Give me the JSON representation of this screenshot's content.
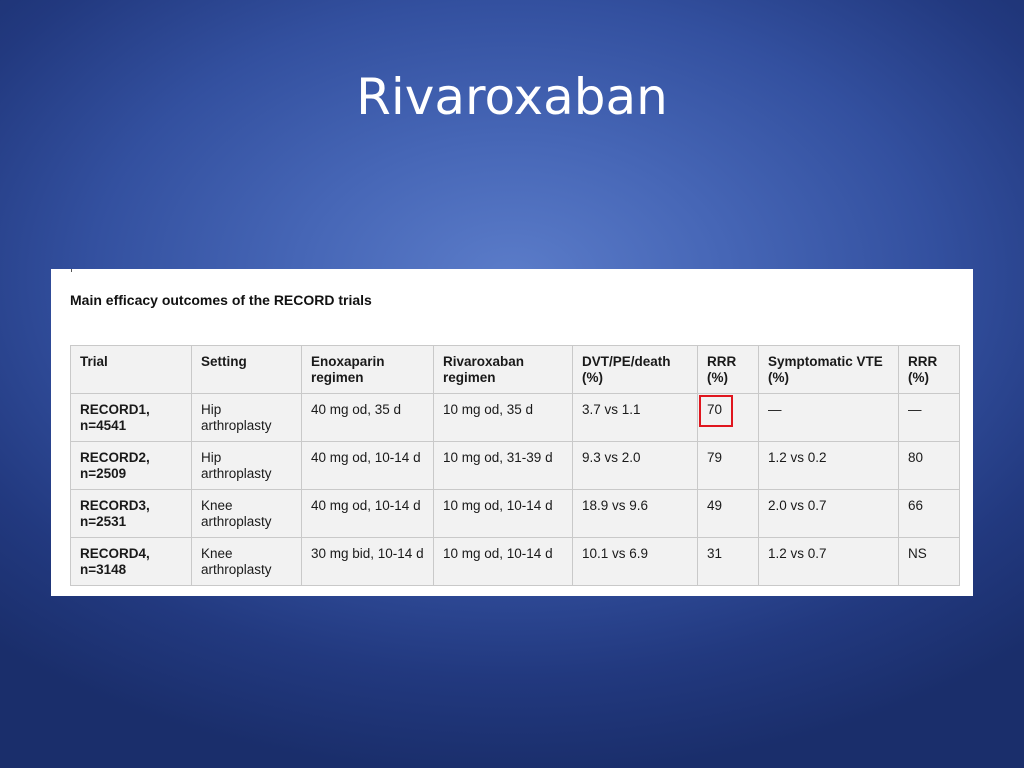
{
  "slide": {
    "title": "Rivaroxaban"
  },
  "table": {
    "caption": "Main efficacy outcomes of the RECORD trials",
    "headers": [
      "Trial",
      "Setting",
      "Enoxaparin regimen",
      "Rivaroxaban regimen",
      "DVT/PE/death (%)",
      "RRR (%)",
      "Symptomatic VTE (%)",
      "RRR (%)"
    ],
    "rows": [
      {
        "trial": "RECORD1, n=4541",
        "setting": "Hip arthroplasty",
        "enoxaparin": "40 mg od, 35 d",
        "rivaroxaban": "10 mg od, 35 d",
        "dvt_pe_death": "3.7 vs 1.1",
        "rrr": "70",
        "symptomatic_vte": "—",
        "rrr_vte": "—"
      },
      {
        "trial": "RECORD2, n=2509",
        "setting": "Hip arthroplasty",
        "enoxaparin": "40 mg od, 10-14 d",
        "rivaroxaban": "10 mg od, 31-39 d",
        "dvt_pe_death": "9.3 vs 2.0",
        "rrr": "79",
        "symptomatic_vte": "1.2 vs 0.2",
        "rrr_vte": "80"
      },
      {
        "trial": "RECORD3, n=2531",
        "setting": "Knee arthroplasty",
        "enoxaparin": "40 mg od, 10-14 d",
        "rivaroxaban": "10 mg od, 10-14 d",
        "dvt_pe_death": "18.9 vs 9.6",
        "rrr": "49",
        "symptomatic_vte": "2.0 vs 0.7",
        "rrr_vte": "66"
      },
      {
        "trial": "RECORD4, n=3148",
        "setting": "Knee arthroplasty",
        "enoxaparin": "30 mg bid, 10-14 d",
        "rivaroxaban": "10 mg od, 10-14 d",
        "dvt_pe_death": "10.1 vs 6.9",
        "rrr": "31",
        "symptomatic_vte": "1.2 vs 0.7",
        "rrr_vte": "NS"
      }
    ],
    "highlight": {
      "row_index": 0,
      "field": "rrr",
      "color": "#e0161e"
    }
  },
  "colors": {
    "background_center": "#5b7cc9",
    "background_edge": "#1a2e6b",
    "title_text": "#ffffff",
    "cell_background": "#f2f2f2",
    "cell_border": "#c9c9c9"
  }
}
